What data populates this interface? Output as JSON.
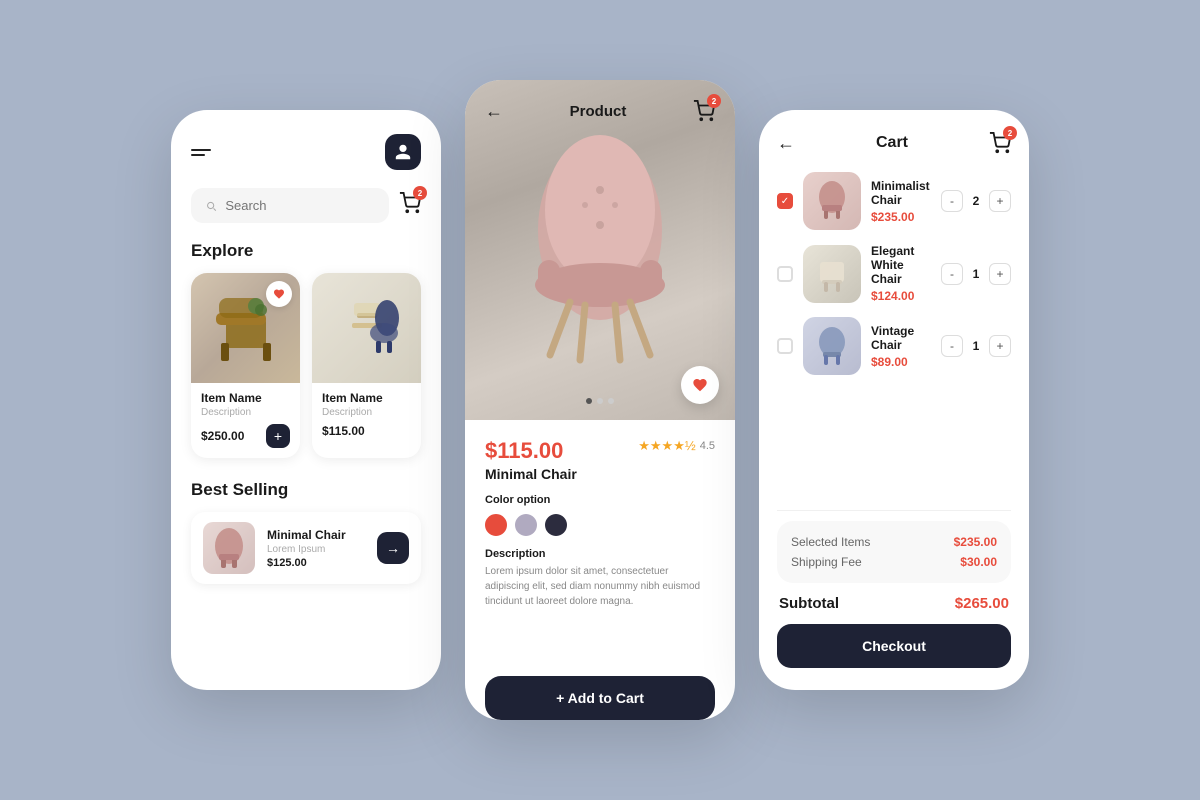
{
  "screens": {
    "home": {
      "header": {
        "search_placeholder": "Search"
      },
      "explore_section": {
        "title": "Explore",
        "items": [
          {
            "name": "Item Name",
            "description": "Description",
            "price": "$250.00",
            "has_favorite": true
          },
          {
            "name": "Item Name",
            "description": "Description",
            "price": "$115.00",
            "has_favorite": false
          }
        ]
      },
      "best_selling_section": {
        "title": "Best Selling",
        "items": [
          {
            "name": "Minimal Chair",
            "description": "Lorem Ipsum",
            "price": "$125.00"
          }
        ]
      }
    },
    "product": {
      "title": "Product",
      "price": "$115.00",
      "name": "Minimal Chair",
      "rating": "4.5",
      "color_option_label": "Color option",
      "colors": [
        "#e74c3c",
        "#b0aac0",
        "#2c2c3e"
      ],
      "description_label": "Description",
      "description_text": "Lorem ipsum dolor sit amet, consectetuer adipiscing elit, sed diam nonummy nibh euismod tincidunt ut laoreet dolore magna.",
      "add_to_cart_label": "+ Add to Cart"
    },
    "cart": {
      "title": "Cart",
      "items": [
        {
          "name": "Minimalist Chair",
          "price": "$235.00",
          "quantity": 2,
          "checked": true
        },
        {
          "name": "Elegant White Chair",
          "price": "$124.00",
          "quantity": 1,
          "checked": false
        },
        {
          "name": "Vintage Chair",
          "price": "$89.00",
          "quantity": 1,
          "checked": false
        }
      ],
      "summary": {
        "selected_items_label": "Selected Items",
        "selected_items_value": "$235.00",
        "shipping_fee_label": "Shipping Fee",
        "shipping_fee_value": "$30.00"
      },
      "subtotal_label": "Subtotal",
      "subtotal_value": "$265.00",
      "checkout_label": "Checkout"
    }
  }
}
